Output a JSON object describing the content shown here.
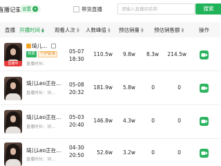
{
  "header": {
    "title": "直播记录",
    "settings_label": "设置",
    "settings_plus": "+",
    "checkbox_label": "带货直播",
    "search_placeholder": "请输入直播间名称",
    "search_button": "搜索"
  },
  "table": {
    "columns": {
      "live": "直播",
      "start_time": "开播时间",
      "viewers": "观看人次",
      "peak": "人数峰值",
      "est_sales": "预估销量",
      "est_revenue": "预估销售额",
      "actions": "操作"
    },
    "rows": [
      {
        "name": "琦儿...",
        "live_badge": "直播中",
        "tags": [
          "热卖",
          "个护家清"
        ],
        "duration": "直播时长：",
        "date": "05-07",
        "time": "18:30",
        "viewers": "110.5w",
        "peak": "9.8w",
        "sales": "8.3w",
        "revenue": "214.5w"
      },
      {
        "name": "琦儿Leo正在...",
        "duration": "直播时长：词…",
        "date": "05-08",
        "time": "20:32",
        "viewers": "181.9w",
        "peak": "5.8w",
        "sales": "0",
        "revenue": "0"
      },
      {
        "name": "琦儿Leo正在...",
        "duration": "直播时长：词…",
        "date": "05-03",
        "time": "20:40",
        "viewers": "146.8w",
        "peak": "4.3w",
        "sales": "0",
        "revenue": "0"
      },
      {
        "name": "琦儿Leo正在...",
        "duration": "直播时长：词…",
        "date": "04-30",
        "time": "20:50",
        "viewers": "52.6w",
        "peak": "3.2w",
        "sales": "0",
        "revenue": "0"
      }
    ]
  },
  "colors": {
    "accent": "#1aa34a",
    "button": "#21b35a",
    "live": "#e83b3b"
  },
  "icons": {
    "op": "video-camera-icon",
    "copy": "copy-icon",
    "settings": "plus-icon"
  }
}
